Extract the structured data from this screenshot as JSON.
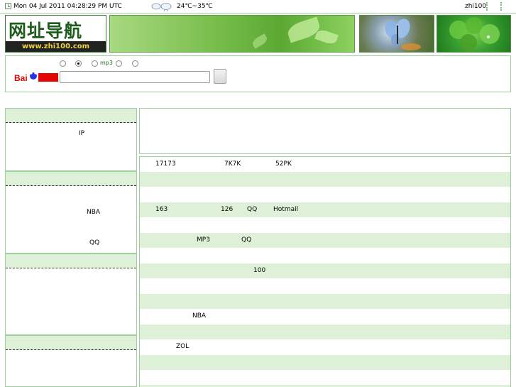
{
  "topbar": {
    "datetime": "Mon 04 Jul 2011 04:28:29 PM UTC",
    "temperature": "24℃~35℃",
    "site_name": "zhi100"
  },
  "logo": {
    "cn": "网址导航",
    "url": "www.zhi100.com"
  },
  "search": {
    "options": [
      {
        "label": "",
        "checked": false
      },
      {
        "label": "",
        "checked": true
      },
      {
        "label": "mp3",
        "checked": false
      },
      {
        "label": "",
        "checked": false
      },
      {
        "label": "",
        "checked": false
      }
    ],
    "input_value": "",
    "button_label": ""
  },
  "left_panels": [
    {
      "text": "IP"
    },
    {
      "text": "NBA",
      "text2": "QQ"
    },
    {
      "text": ""
    },
    {
      "text": ""
    }
  ],
  "rows": [
    {
      "alt": false,
      "cells": [
        "17173",
        "7K7K",
        "52PK"
      ]
    },
    {
      "alt": true,
      "cells": []
    },
    {
      "alt": false,
      "cells": []
    },
    {
      "alt": true,
      "cells": [
        "163",
        "126",
        "QQ",
        "Hotmail"
      ]
    },
    {
      "alt": false,
      "cells": []
    },
    {
      "alt": true,
      "cells": [
        "MP3",
        "QQ"
      ]
    },
    {
      "alt": false,
      "cells": []
    },
    {
      "alt": true,
      "cells": [
        "100"
      ]
    },
    {
      "alt": false,
      "cells": []
    },
    {
      "alt": true,
      "cells": []
    },
    {
      "alt": false,
      "cells": [
        "NBA"
      ]
    },
    {
      "alt": true,
      "cells": []
    },
    {
      "alt": false,
      "cells": [
        "ZOL"
      ]
    },
    {
      "alt": true,
      "cells": []
    },
    {
      "alt": false,
      "cells": []
    },
    {
      "alt": true,
      "cells": []
    }
  ],
  "colors": {
    "accent_green": "#9fcf9f",
    "row_alt": "#dff0d8",
    "logo_text": "#1e5c1e"
  }
}
